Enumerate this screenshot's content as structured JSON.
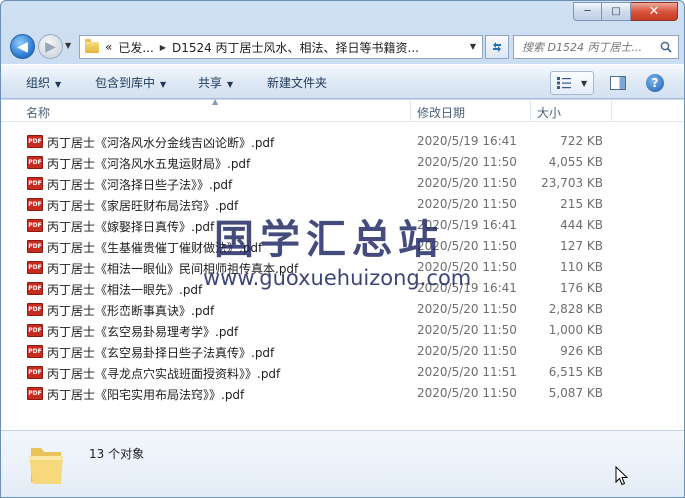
{
  "window": {
    "caption": {
      "minimize": "─",
      "maximize": "□",
      "close": "✕"
    }
  },
  "nav": {
    "back": "◀",
    "forward": "▶",
    "breadcrumb": [
      "«",
      "已发...",
      "D1524 丙丁居士风水、相法、择日等书籍资..."
    ],
    "search_placeholder": "搜索 D1524 丙丁居士..."
  },
  "toolbar": {
    "organize": "组织",
    "include_library": "包含到库中",
    "share": "共享",
    "new_folder": "新建文件夹"
  },
  "columns": {
    "name": "名称",
    "date": "修改日期",
    "size": "大小"
  },
  "files": [
    {
      "name": "丙丁居士《河洛风水分金线吉凶论断》.pdf",
      "date": "2020/5/19 16:41",
      "size": "722 KB"
    },
    {
      "name": "丙丁居士《河洛风水五鬼运财局》.pdf",
      "date": "2020/5/20 11:50",
      "size": "4,055 KB"
    },
    {
      "name": "丙丁居士《河洛择日些子法》》.pdf",
      "date": "2020/5/20 11:50",
      "size": "23,703 KB"
    },
    {
      "name": "丙丁居士《家居旺财布局法窍》.pdf",
      "date": "2020/5/20 11:50",
      "size": "215 KB"
    },
    {
      "name": "丙丁居士《嫁娶择日真传》.pdf",
      "date": "2020/5/19 16:41",
      "size": "444 KB"
    },
    {
      "name": "丙丁居士《生基催贵催丁催财做法》.pdf",
      "date": "2020/5/20 11:50",
      "size": "127 KB"
    },
    {
      "name": "丙丁居士《相法一眼仙》民间相师祖传真本.pdf",
      "date": "2020/5/20 11:50",
      "size": "110 KB"
    },
    {
      "name": "丙丁居士《相法一眼先》.pdf",
      "date": "2020/5/19 16:41",
      "size": "176 KB"
    },
    {
      "name": "丙丁居士《形峦断事真诀》.pdf",
      "date": "2020/5/20 11:50",
      "size": "2,828 KB"
    },
    {
      "name": "丙丁居士《玄空易卦易理考学》.pdf",
      "date": "2020/5/20 11:50",
      "size": "1,000 KB"
    },
    {
      "name": "丙丁居士《玄空易卦择日些子法真传》.pdf",
      "date": "2020/5/20 11:50",
      "size": "926 KB"
    },
    {
      "name": "丙丁居士《寻龙点穴实战班面授资料》》.pdf",
      "date": "2020/5/20 11:51",
      "size": "6,515 KB"
    },
    {
      "name": "丙丁居士《阳宅实用布局法窍》》.pdf",
      "date": "2020/5/20 11:50",
      "size": "5,087 KB"
    }
  ],
  "file_icon_label": "PDF",
  "details": {
    "count": "13 个对象"
  },
  "watermark": {
    "title": "国学汇总站",
    "url": "www.guoxuehuizong.com"
  },
  "colors": {
    "accent": "#1e395b",
    "pdf_red": "#c62b1e",
    "watermark": "#1c2460"
  }
}
